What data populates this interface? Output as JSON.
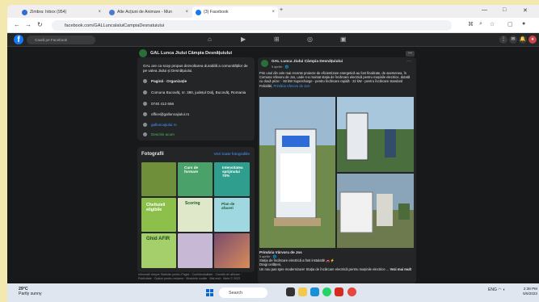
{
  "browser": {
    "tabs": [
      {
        "label": "Zimbra: Inbox (954)",
        "color": "#2f6fd2"
      },
      {
        "label": "Alte Acțiuni de Animare - Mun",
        "color": "#4a7bd0"
      },
      {
        "label": "(3) Facebook",
        "color": "#1877f2"
      }
    ],
    "new_tab": "+",
    "url": "facebook.com/GALLuncaIaluiCampiaDesnatuiului"
  },
  "fb": {
    "logo": "f",
    "search_placeholder": "Caută pe Facebook"
  },
  "page": {
    "name": "GAL Lunca Jiului Câmpia Desnățuiului",
    "intro": "GAL are ca scop propus dezvoltarea durabilă a comunităților de pe valea Jiului și Desnățuiului.",
    "info": [
      {
        "text": "Pagină · Organizație",
        "style": "bold"
      },
      {
        "text": "Comuna Bucovăț, nr. 380, județul Dolj, Bucovăț, Romania",
        "style": "normal"
      },
      {
        "text": "0740 412 656",
        "style": "normal"
      },
      {
        "text": "office@galluncajiului.ro",
        "style": "normal"
      },
      {
        "text": "galluncajiului.ro",
        "style": "link"
      },
      {
        "text": "Deschis acum",
        "style": "green"
      }
    ]
  },
  "photos": {
    "title": "Fotografii",
    "see_all": "Vezi toate fotografiile",
    "tiles": [
      {
        "text": "",
        "bg": "#6f8f3a"
      },
      {
        "text": "Curs de formare",
        "bg": "#4aa16a"
      },
      {
        "text": "Intensitatea sprijinului 70%",
        "bg": "#2f9e8f"
      },
      {
        "text": "Cheltuieli eligibile",
        "bg": "#8cc04b"
      },
      {
        "text": "Scoring",
        "bg": "#dfe9c9"
      },
      {
        "text": "Plan de afaceri",
        "bg": "#9fd8e0"
      },
      {
        "text": "Ghid AFIR",
        "bg": "#a5cf6b"
      },
      {
        "text": "",
        "bg": "#c7b9d6"
      },
      {
        "text": "",
        "bg": "#7a4b6e"
      }
    ]
  },
  "footer": "Informații despre Statistici pentru Pagini · Confidențialitate · Condiții de utilizare · Publicitate · Opțiuni pentru reclame · Modulele cookie · Mai mult · Meta © 2023",
  "post": {
    "author": "GAL Lunca Jiului Câmpia Desnățuiului",
    "date": "5 aprilie · 🌐",
    "text": "Prin unul din cele mai recente proiecte de eficientizare energetică au fost finalizate, de asemenea, în Comuna Vârvoru de Jos, unde s-a montat stația de încărcare electrică pentru mașinile electrice, dotată cu două prize: · 60 kW Supercharge - pentru încărcare rapidă · 22 kW - pentru încărcare standard Felicitări,",
    "text_link": "Primăria Vârvoru de Jos!"
  },
  "comment": {
    "author": "Primăria Vârvoru de Jos",
    "date": "5 aprilie · 🌐",
    "line1": "Stația de încărcare electrică a fost instalată! 🚗⚡",
    "line2": "Dragi cetățeni,",
    "line3": "Un nou pas spre modernizare! Stația de încărcare electrică pentru mașinile electrice ...",
    "more": "Vezi mai mult"
  },
  "taskbar": {
    "temp": "29°C",
    "weather": "Partly sunny",
    "search": "Search",
    "lang": "ENG",
    "time": "2:38 PM",
    "date": "5/6/2023"
  }
}
